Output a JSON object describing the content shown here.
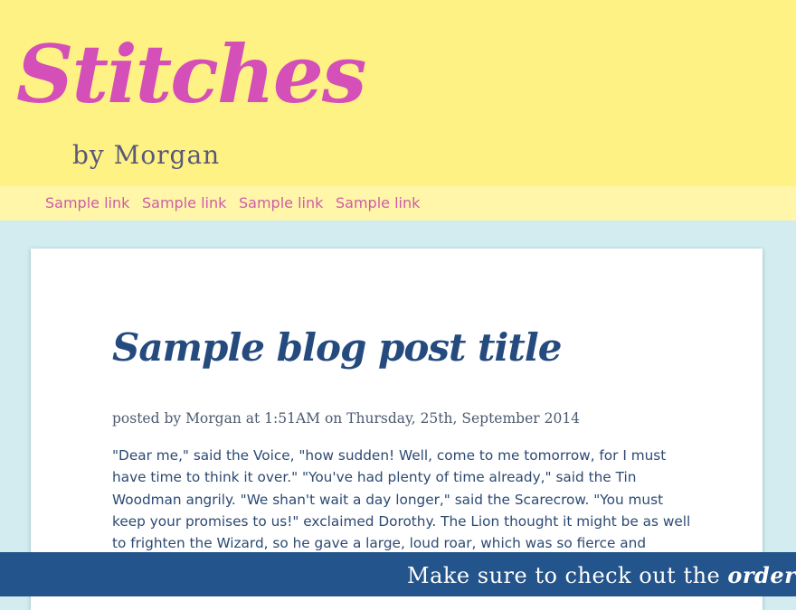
{
  "site": {
    "title": "Stitches",
    "byline": "by Morgan"
  },
  "nav": {
    "links": [
      {
        "label": "Sample link"
      },
      {
        "label": "Sample link"
      },
      {
        "label": "Sample link"
      },
      {
        "label": "Sample link"
      }
    ]
  },
  "post": {
    "title": "Sample blog post title",
    "meta": "posted by Morgan at 1:51AM on Thursday, 25th, September 2014",
    "body": "\"Dear me,\" said the Voice, \"how sudden! Well, come to me tomorrow, for I must have time to think it over.\" \"You've had plenty of time already,\" said the Tin Woodman angrily. \"We shan't wait a day longer,\" said the Scarecrow. \"You must keep your promises to us!\" exclaimed Dorothy. The Lion thought it might be as well to frighten the Wizard, so he gave a large, loud roar, which was so fierce and dreadful that Toto"
  },
  "banner": {
    "prefix": "Make sure to check out the ",
    "link_label": "orders page"
  },
  "colors": {
    "header_bg": "#fef285",
    "nav_bg": "#fff6a9",
    "page_bg": "#d2ecf0",
    "title_pink": "#d44fb8",
    "post_title_blue": "#244a7e",
    "banner_bg": "#23548b"
  }
}
